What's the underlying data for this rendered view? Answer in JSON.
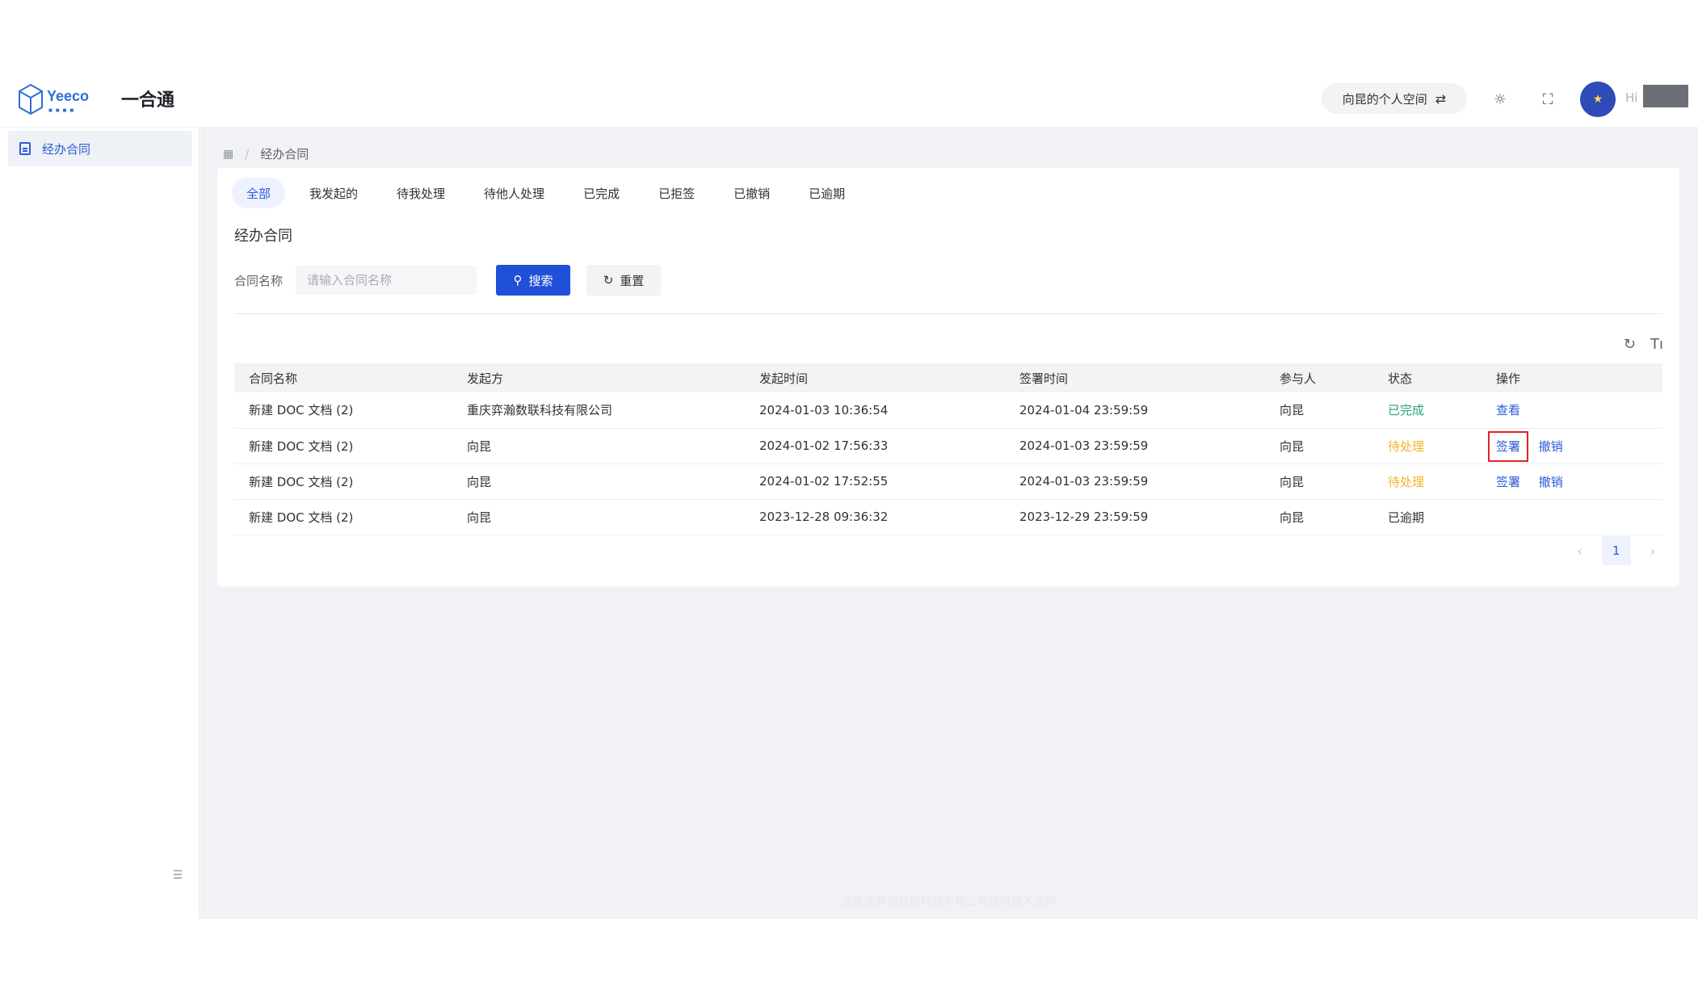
{
  "header": {
    "logo_text": "Yeeco",
    "app_title": "一合通",
    "space_label": "向昆的个人空间",
    "space_switch_icon": "swap-icon",
    "hi_label": "Hi"
  },
  "sidebar": {
    "items": [
      {
        "label": "经办合同",
        "icon": "document-icon"
      }
    ],
    "collapse_icon": "collapse-icon"
  },
  "breadcrumb": {
    "root_icon": "grid-icon",
    "current": "经办合同"
  },
  "tabs": [
    {
      "label": "全部",
      "active": true
    },
    {
      "label": "我发起的"
    },
    {
      "label": "待我处理"
    },
    {
      "label": "待他人处理"
    },
    {
      "label": "已完成"
    },
    {
      "label": "已拒签"
    },
    {
      "label": "已撤销"
    },
    {
      "label": "已逾期"
    }
  ],
  "card_title": "经办合同",
  "search": {
    "label": "合同名称",
    "placeholder": "请输入合同名称",
    "search_button": "搜索",
    "reset_button": "重置"
  },
  "table": {
    "columns": [
      "合同名称",
      "发起方",
      "发起时间",
      "签署时间",
      "参与人",
      "状态",
      "操作"
    ],
    "rows": [
      {
        "name": "新建 DOC 文档 (2)",
        "initiator": "重庆弈瀚数联科技有限公司",
        "start": "2024-01-03 10:36:54",
        "sign": "2024-01-04 23:59:59",
        "participant": "向昆",
        "status": "已完成",
        "actions": [
          "查看"
        ]
      },
      {
        "name": "新建 DOC 文档 (2)",
        "initiator": "向昆",
        "start": "2024-01-02 17:56:33",
        "sign": "2024-01-03 23:59:59",
        "participant": "向昆",
        "status": "待处理",
        "actions": [
          "签署",
          "撤销"
        ]
      },
      {
        "name": "新建 DOC 文档 (2)",
        "initiator": "向昆",
        "start": "2024-01-02 17:52:55",
        "sign": "2024-01-03 23:59:59",
        "participant": "向昆",
        "status": "待处理",
        "actions": [
          "签署",
          "撤销"
        ]
      },
      {
        "name": "新建 DOC 文档 (2)",
        "initiator": "向昆",
        "start": "2023-12-28 09:36:32",
        "sign": "2023-12-29 23:59:59",
        "participant": "向昆",
        "status": "已逾期",
        "actions": []
      }
    ]
  },
  "pagination": {
    "current_page": "1"
  },
  "footer": "@重庆弈瀚数联科技有限公司提供技术支持",
  "colors": {
    "accent": "#2050d8",
    "done": "#2ba471",
    "pending": "#f0b429"
  }
}
